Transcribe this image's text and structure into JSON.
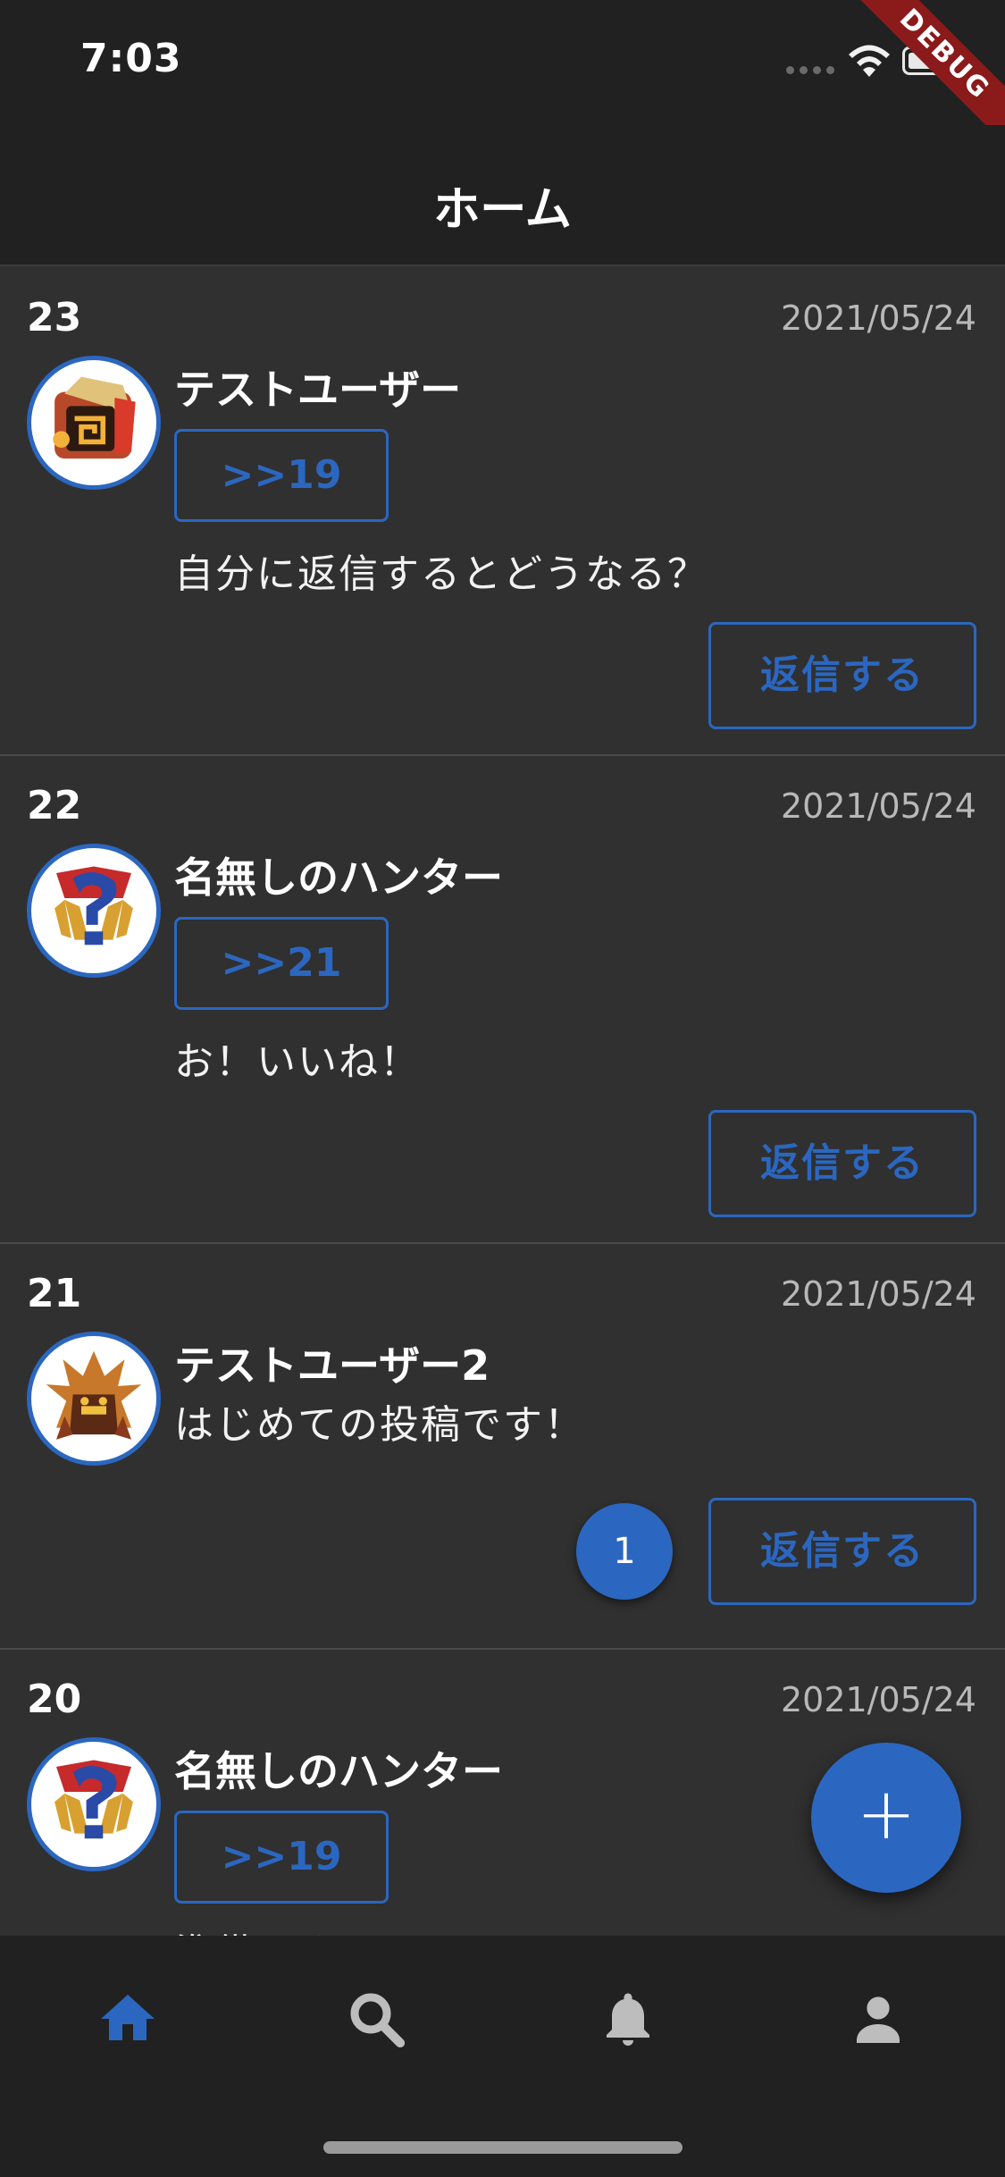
{
  "status_bar": {
    "time": "7:03",
    "debug_label": "DEBUG"
  },
  "app_bar": {
    "title": "ホーム"
  },
  "posts": [
    {
      "number": "23",
      "date": "2021/05/24",
      "user": "テストユーザー",
      "reply_to": ">>19",
      "body": "自分に返信するとどうなる？",
      "reply_label": "返信する",
      "avatar_icon": "monster-crest-icon"
    },
    {
      "number": "22",
      "date": "2021/05/24",
      "user": "名無しのハンター",
      "reply_to": ">>21",
      "body": "お！いいね！",
      "reply_label": "返信する",
      "avatar_icon": "question-crest-icon"
    },
    {
      "number": "21",
      "date": "2021/05/24",
      "user": "テストユーザー2",
      "body": "はじめての投稿です！",
      "reply_count": "1",
      "reply_label": "返信する",
      "avatar_icon": "monster-crest-icon"
    },
    {
      "number": "20",
      "date": "2021/05/24",
      "user": "名無しのハンター",
      "reply_to": ">>19",
      "body": "準備できました",
      "avatar_icon": "question-crest-icon"
    }
  ],
  "fab": {
    "label": "+"
  },
  "bottom_nav": {
    "items": [
      {
        "icon": "home-icon",
        "active": true
      },
      {
        "icon": "search-icon",
        "active": false
      },
      {
        "icon": "bell-icon",
        "active": false
      },
      {
        "icon": "person-icon",
        "active": false
      }
    ]
  },
  "colors": {
    "accent": "#2b67c0",
    "background": "#303030",
    "bar": "#212121"
  }
}
